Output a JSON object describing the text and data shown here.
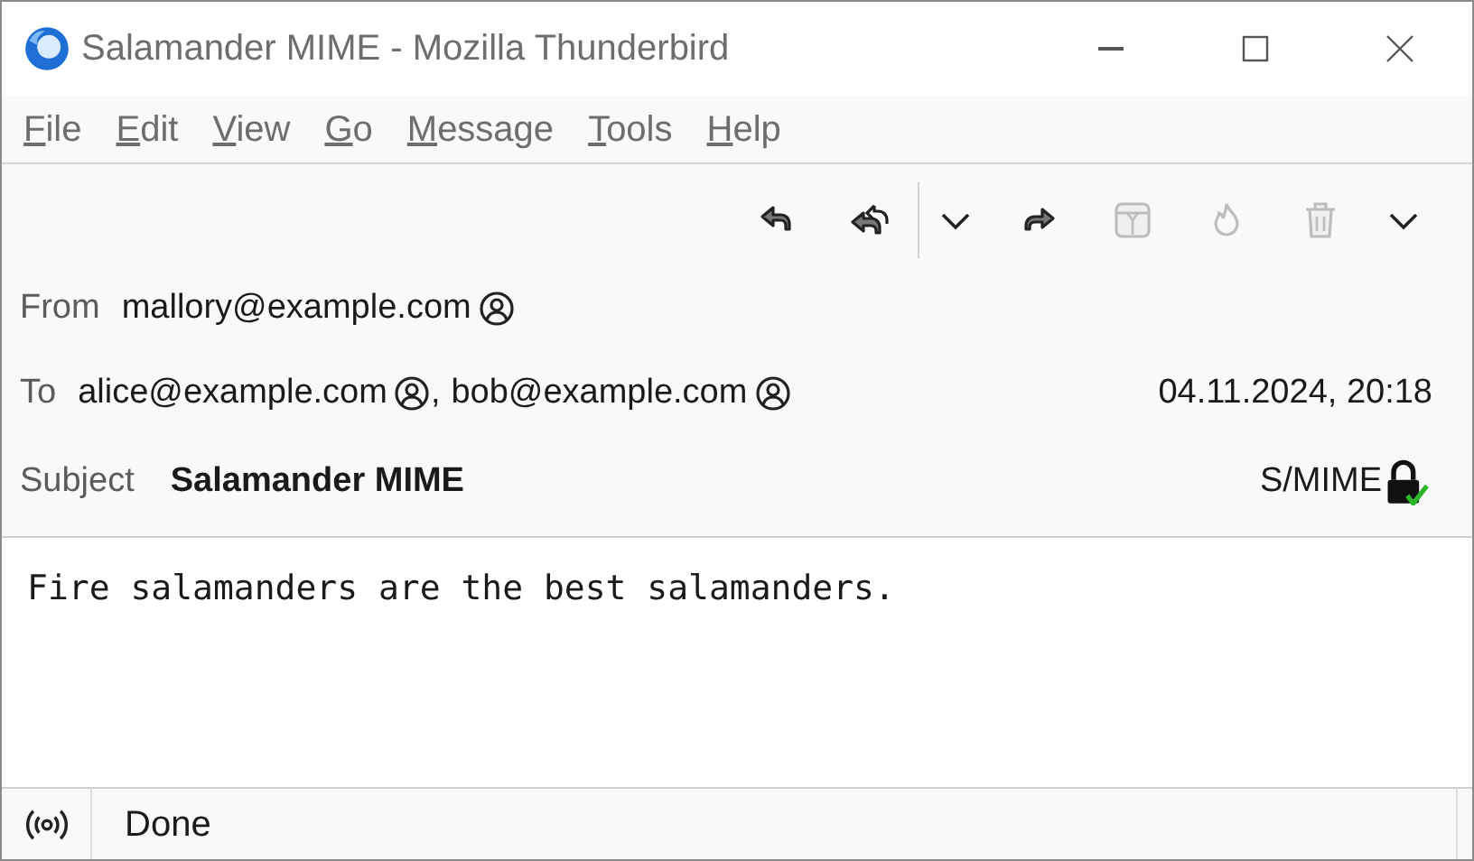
{
  "window": {
    "title": "Salamander MIME - Mozilla Thunderbird"
  },
  "menu": [
    "File",
    "Edit",
    "View",
    "Go",
    "Message",
    "Tools",
    "Help"
  ],
  "toolbar": [
    {
      "kind": "reply",
      "disabled": false
    },
    {
      "kind": "reply-all",
      "disabled": false
    },
    {
      "kind": "separator"
    },
    {
      "kind": "dropdown",
      "disabled": false
    },
    {
      "kind": "forward",
      "disabled": false
    },
    {
      "kind": "archive",
      "disabled": true
    },
    {
      "kind": "junk",
      "disabled": true
    },
    {
      "kind": "delete",
      "disabled": true
    },
    {
      "kind": "dropdown",
      "disabled": false
    }
  ],
  "header": {
    "from_label": "From",
    "from": [
      "mallory@example.com"
    ],
    "to_label": "To",
    "to": [
      "alice@example.com",
      "bob@example.com"
    ],
    "to_separator": ",",
    "date": "04.11.2024, 20:18",
    "subject_label": "Subject",
    "subject": "Salamander MIME",
    "security": {
      "label": "S/MIME",
      "signed": true
    }
  },
  "body": "Fire salamanders are the best salamanders.",
  "status_bar": {
    "text": "Done"
  }
}
